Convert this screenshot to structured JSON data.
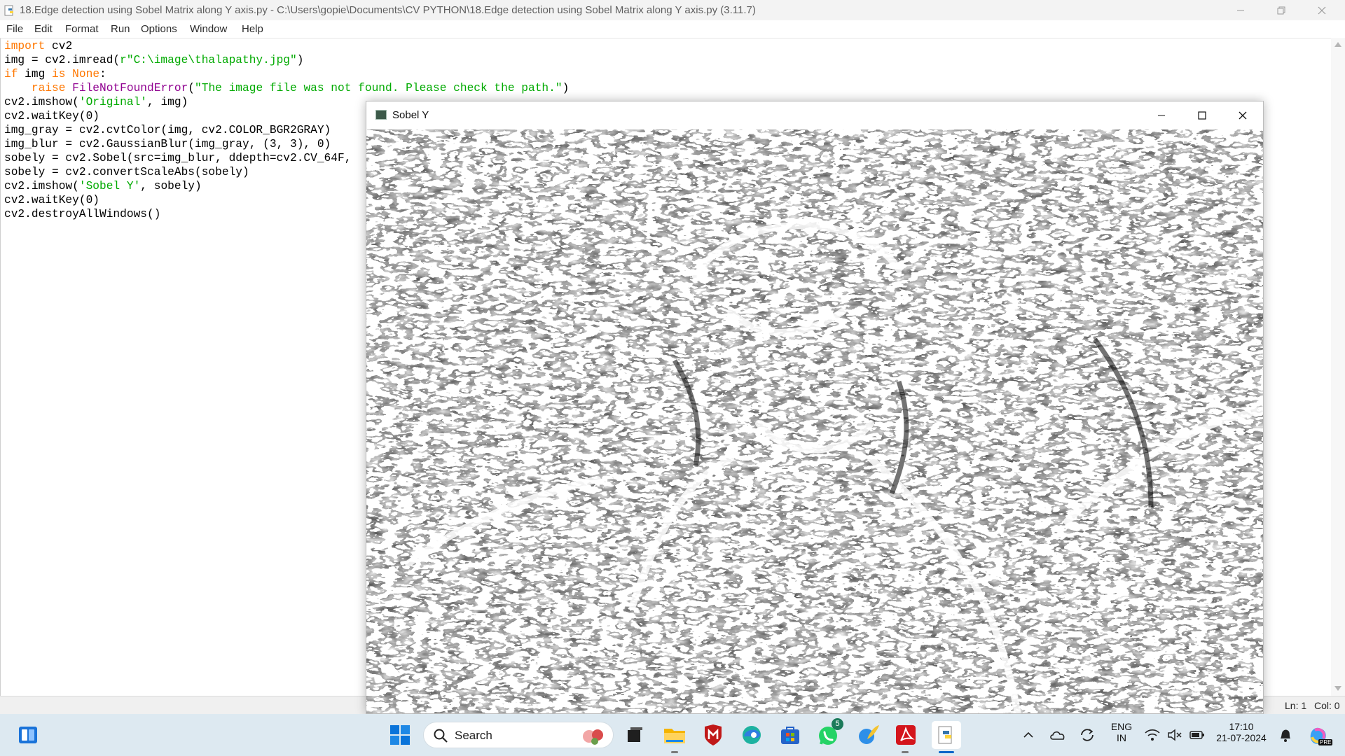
{
  "editor_window": {
    "title": "18.Edge detection using Sobel Matrix along Y axis.py - C:\\Users\\gopie\\Documents\\CV PYTHON\\18.Edge detection using Sobel Matrix along Y axis.py (3.11.7)",
    "menu": [
      "File",
      "Edit",
      "Format",
      "Run",
      "Options",
      "Window",
      "Help"
    ],
    "code_lines": [
      [
        {
          "t": "import",
          "c": "kw"
        },
        {
          "t": " cv2"
        }
      ],
      [
        {
          "t": "img = cv2.imread("
        },
        {
          "t": "r\"C:\\image\\thalapathy.jpg\"",
          "c": "st"
        },
        {
          "t": ")"
        }
      ],
      [
        {
          "t": "if",
          "c": "kw"
        },
        {
          "t": " img "
        },
        {
          "t": "is",
          "c": "kw"
        },
        {
          "t": " "
        },
        {
          "t": "None",
          "c": "kw"
        },
        {
          "t": ":"
        }
      ],
      [
        {
          "t": "    "
        },
        {
          "t": "raise",
          "c": "kw"
        },
        {
          "t": " "
        },
        {
          "t": "FileNotFoundError",
          "c": "bi"
        },
        {
          "t": "("
        },
        {
          "t": "\"The image file was not found. Please check the path.\"",
          "c": "st"
        },
        {
          "t": ")"
        }
      ],
      [
        {
          "t": "cv2.imshow("
        },
        {
          "t": "'Original'",
          "c": "st"
        },
        {
          "t": ", img)"
        }
      ],
      [
        {
          "t": "cv2.waitKey(0)"
        }
      ],
      [
        {
          "t": "img_gray = cv2.cvtColor(img, cv2.COLOR_BGR2GRAY)"
        }
      ],
      [
        {
          "t": "img_blur = cv2.GaussianBlur(img_gray, (3, 3), 0)"
        }
      ],
      [
        {
          "t": "sobely = cv2.Sobel(src=img_blur, ddepth=cv2.CV_64F,"
        }
      ],
      [
        {
          "t": "sobely = cv2.convertScaleAbs(sobely)"
        }
      ],
      [
        {
          "t": "cv2.imshow("
        },
        {
          "t": "'Sobel Y'",
          "c": "st"
        },
        {
          "t": ", sobely)"
        }
      ],
      [
        {
          "t": "cv2.waitKey(0)"
        }
      ],
      [
        {
          "t": "cv2.destroyAllWindows()"
        }
      ]
    ],
    "status": {
      "line": "Ln: 1",
      "col": "Col: 0"
    }
  },
  "image_window": {
    "title": "Sobel Y"
  },
  "taskbar": {
    "search_placeholder": "Search",
    "whatsapp_badge": "5",
    "language": {
      "line1": "ENG",
      "line2": "IN"
    },
    "clock": {
      "time": "17:10",
      "date": "21-07-2024"
    },
    "copilot_badge": "PRE",
    "pinned": [
      "task-view-icon",
      "file-explorer-icon",
      "mcafee-icon",
      "edge-icon",
      "microsoft-store-icon",
      "whatsapp-icon",
      "python-feather-icon",
      "acrobat-icon",
      "idle-icon"
    ]
  },
  "colors": {
    "keyword": "#ff7700",
    "builtin": "#900090",
    "string": "#00aa00",
    "taskbar": "#dde9f1"
  }
}
